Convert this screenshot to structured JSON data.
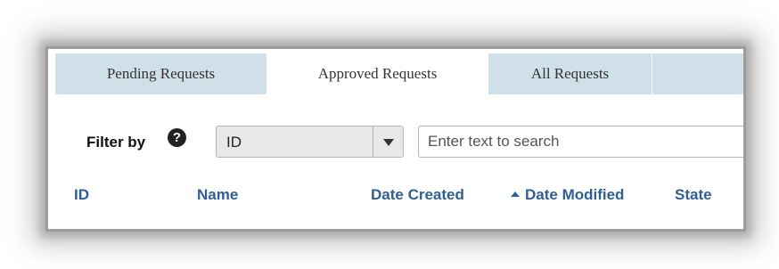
{
  "tabs": [
    {
      "label": "Pending Requests",
      "active": false
    },
    {
      "label": "Approved Requests",
      "active": true
    },
    {
      "label": "All Requests",
      "active": false
    }
  ],
  "filter": {
    "label": "Filter by",
    "help_icon": "question-circle-icon",
    "select_value": "ID",
    "search_placeholder": "Enter text to search"
  },
  "columns": {
    "id": "ID",
    "name": "Name",
    "date_created": "Date Created",
    "date_modified": "Date Modified",
    "state": "State"
  },
  "sort": {
    "column": "date_modified",
    "direction": "ascending"
  },
  "colors": {
    "tab_bar": "#cfe0e8",
    "header_text": "#2f5f93"
  }
}
